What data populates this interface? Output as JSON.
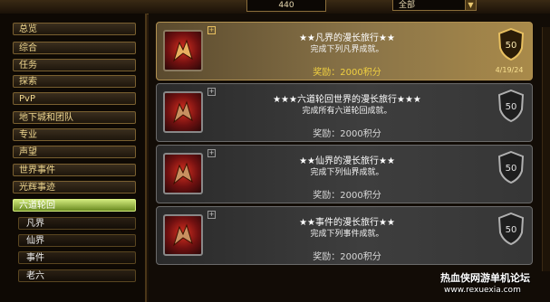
{
  "header": {
    "points": "440",
    "filter_value": "全部",
    "filter_arrow": "▼"
  },
  "sidebar": {
    "categories": [
      {
        "label": "总览"
      },
      {
        "label": "综合"
      },
      {
        "label": "任务"
      },
      {
        "label": "探索"
      },
      {
        "label": "PvP"
      },
      {
        "label": "地下城和团队"
      },
      {
        "label": "专业"
      },
      {
        "label": "声望"
      },
      {
        "label": "世界事件"
      },
      {
        "label": "光辉事迹"
      },
      {
        "label": "六道轮回",
        "active": true
      }
    ],
    "subcategories": [
      {
        "label": "凡界"
      },
      {
        "label": "仙界"
      },
      {
        "label": "事件"
      },
      {
        "label": "老六"
      }
    ]
  },
  "achievements": [
    {
      "title": "★★凡界的漫长旅行★★",
      "description": "完成下列凡界成就。",
      "reward": "奖励：2000积分",
      "points": "50",
      "completed": true,
      "date": "4/19/24"
    },
    {
      "title": "★★★六道轮回世界的漫长旅行★★★",
      "description": "完成所有六道轮回成就。",
      "reward": "奖励：2000积分",
      "points": "50",
      "completed": false,
      "date": ""
    },
    {
      "title": "★★仙界的漫长旅行★★",
      "description": "完成下列仙界成就。",
      "reward": "奖励：2000积分",
      "points": "50",
      "completed": false,
      "date": ""
    },
    {
      "title": "★★事件的漫长旅行★★",
      "description": "完成下列事件成就。",
      "reward": "奖励：2000积分",
      "points": "50",
      "completed": false,
      "date": ""
    }
  ],
  "watermark": {
    "line1": "热血侠网游单机论坛",
    "line2": "www.rexuexia.com"
  },
  "colors": {
    "completed_card": "#8a7448",
    "incomplete_card": "#3e3e3e",
    "reward_gold": "#f0d040",
    "active_category": "#9ac040"
  },
  "icons": {
    "achievement": "dragon-emblem-icon",
    "shield": "shield-points-icon",
    "expand": "plus-icon"
  }
}
